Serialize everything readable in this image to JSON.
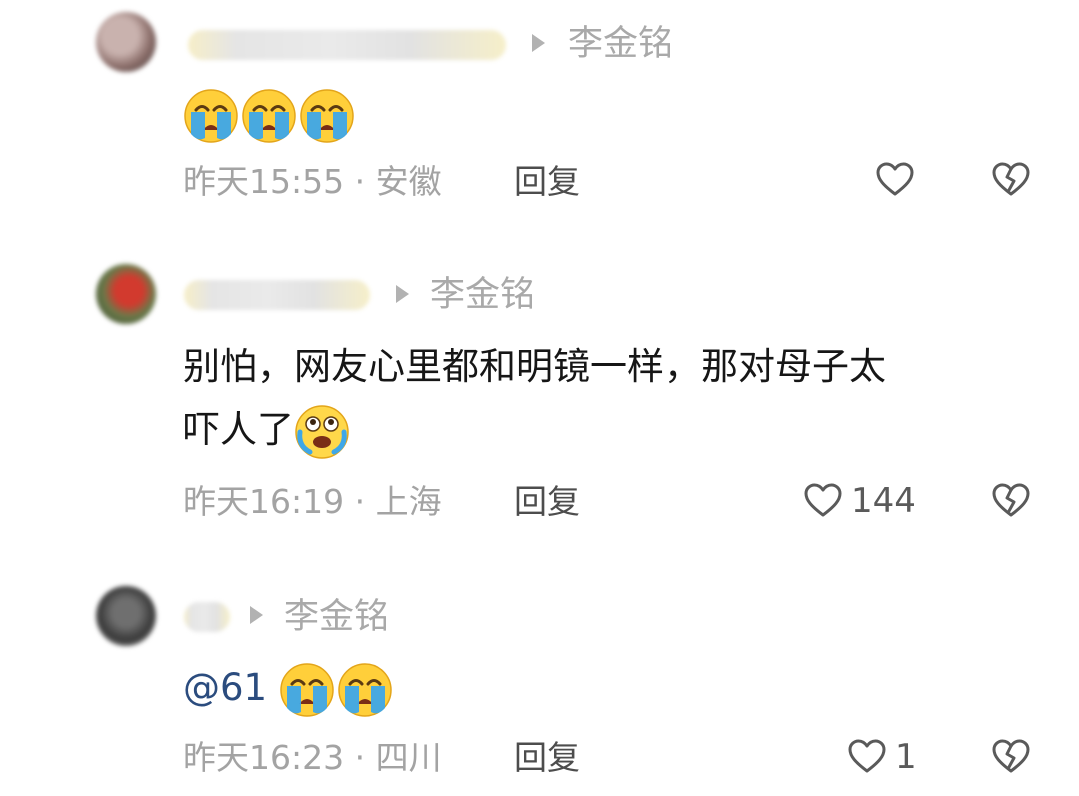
{
  "comments": [
    {
      "reply_to": "李金铭",
      "text": "",
      "emojis": [
        "cry-emoji",
        "cry-emoji",
        "cry-emoji"
      ],
      "time": "昨天15:55",
      "separator": "·",
      "location": "安徽",
      "reply_label": "回复",
      "like_count": ""
    },
    {
      "reply_to": "李金铭",
      "text_line1": "别怕，网友心里都和明镜一样，那对母子太",
      "text_line2": "吓人了",
      "emojis": [
        "terrified-emoji"
      ],
      "time": "昨天16:19",
      "separator": "·",
      "location": "上海",
      "reply_label": "回复",
      "like_count": "144"
    },
    {
      "reply_to": "李金铭",
      "mention": "@61",
      "emojis": [
        "cry-emoji",
        "cry-emoji"
      ],
      "time": "昨天16:23",
      "separator": "·",
      "location": "四川",
      "reply_label": "回复",
      "like_count": "1"
    }
  ],
  "colors": {
    "meta": "#a3a3a3",
    "text": "#161616",
    "mention": "#2b4c7e",
    "icon": "#5a5a5a"
  }
}
